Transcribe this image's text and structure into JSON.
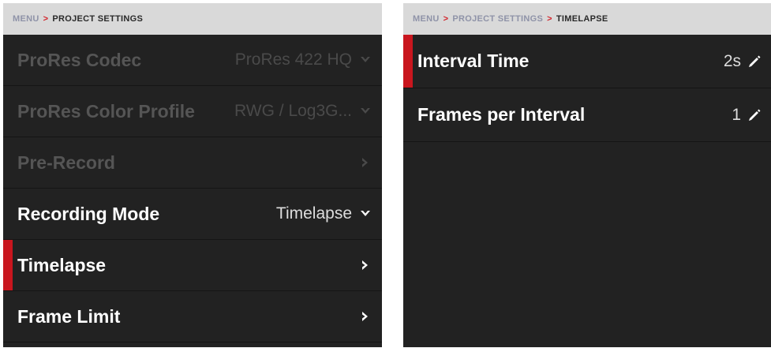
{
  "left_panel": {
    "breadcrumb": [
      {
        "label": "MENU",
        "active": false
      },
      {
        "label": "PROJECT SETTINGS",
        "active": true
      }
    ],
    "separator": ">",
    "rows": [
      {
        "label": "ProRes Codec",
        "value": "ProRes 422 HQ",
        "icon": "chevron-down-icon",
        "disabled": true
      },
      {
        "label": "ProRes Color Profile",
        "value": "RWG / Log3G...",
        "icon": "chevron-down-icon",
        "disabled": true
      },
      {
        "label": "Pre-Record",
        "value": "",
        "icon": "chevron-right-icon",
        "disabled": true
      },
      {
        "label": "Recording Mode",
        "value": "Timelapse",
        "icon": "chevron-down-icon",
        "disabled": false
      },
      {
        "label": "Timelapse",
        "value": "",
        "icon": "chevron-right-icon",
        "disabled": false,
        "selected": true
      },
      {
        "label": "Frame Limit",
        "value": "",
        "icon": "chevron-right-icon",
        "disabled": false
      }
    ]
  },
  "right_panel": {
    "breadcrumb": [
      {
        "label": "MENU",
        "active": false
      },
      {
        "label": "PROJECT SETTINGS",
        "active": false
      },
      {
        "label": "TIMELAPSE",
        "active": true
      }
    ],
    "separator": ">",
    "rows": [
      {
        "label": "Interval Time",
        "value": "2s",
        "icon": "pencil-icon",
        "selected": true
      },
      {
        "label": "Frames per Interval",
        "value": "1",
        "icon": "pencil-icon",
        "selected": false
      }
    ]
  },
  "colors": {
    "accent": "#c9161e",
    "panel_bg": "#222222",
    "breadcrumb_bg": "#d9d9d9"
  }
}
